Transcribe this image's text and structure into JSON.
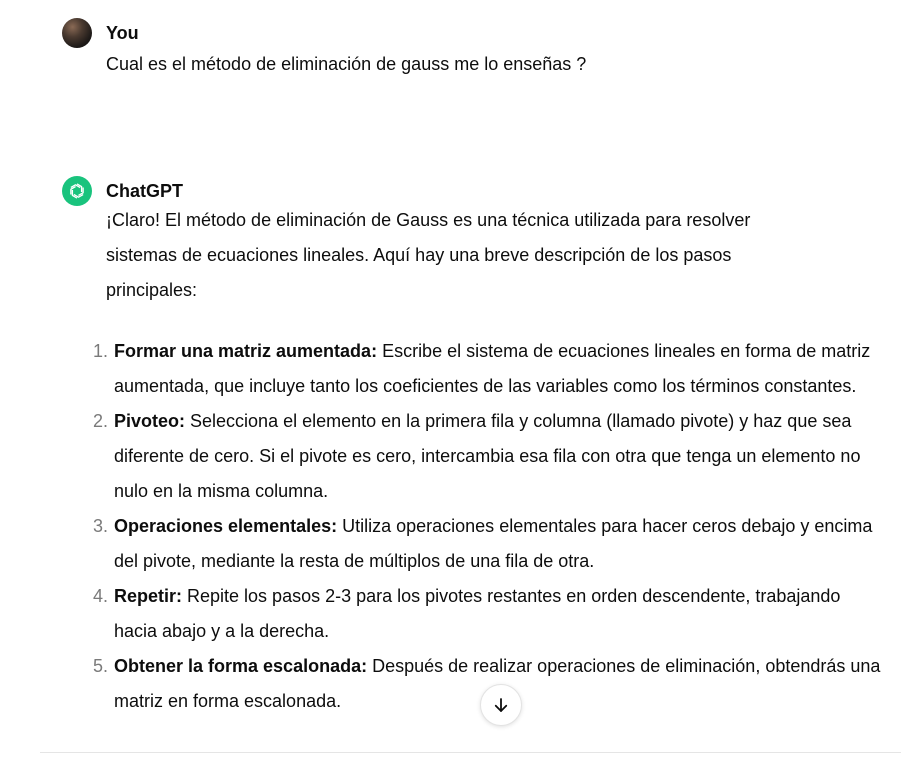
{
  "user_message": {
    "author": "You",
    "text": "Cual es el método de eliminación de gauss me lo enseñas ?"
  },
  "assistant_message": {
    "author": "ChatGPT",
    "intro": "¡Claro! El método de eliminación de Gauss es una técnica utilizada para resolver sistemas de ecuaciones lineales. Aquí hay una breve descripción de los pasos principales:",
    "steps": [
      {
        "number": "1.",
        "title": "Formar una matriz aumentada:",
        "text": "Escribe el sistema de ecuaciones lineales en forma de matriz aumentada, que incluye tanto los coeficientes de las variables como los términos constantes."
      },
      {
        "number": "2.",
        "title": "Pivoteo:",
        "text": "Selecciona el elemento en la primera fila y columna (llamado pivote) y haz que sea diferente de cero. Si el pivote es cero, intercambia esa fila con otra que tenga un elemento no nulo en la misma columna."
      },
      {
        "number": "3.",
        "title": "Operaciones elementales:",
        "text": "Utiliza operaciones elementales para hacer ceros debajo y encima del pivote, mediante la resta de múltiplos de una fila de otra."
      },
      {
        "number": "4.",
        "title": "Repetir:",
        "text": "Repite los pasos 2-3 para los pivotes restantes en orden descendente, trabajando hacia abajo y a la derecha."
      },
      {
        "number": "5.",
        "title": "Obtener la forma escalonada:",
        "text": "Después de realizar operaciones de eliminación, obtendrás una matriz en forma escalonada."
      }
    ]
  },
  "icons": {
    "user_avatar": "user-avatar",
    "assistant_avatar": "openai-logo-icon",
    "scroll_down": "arrow-down-icon"
  },
  "colors": {
    "assistant_avatar_bg": "#19c37d",
    "list_number": "#7a7a7a"
  }
}
